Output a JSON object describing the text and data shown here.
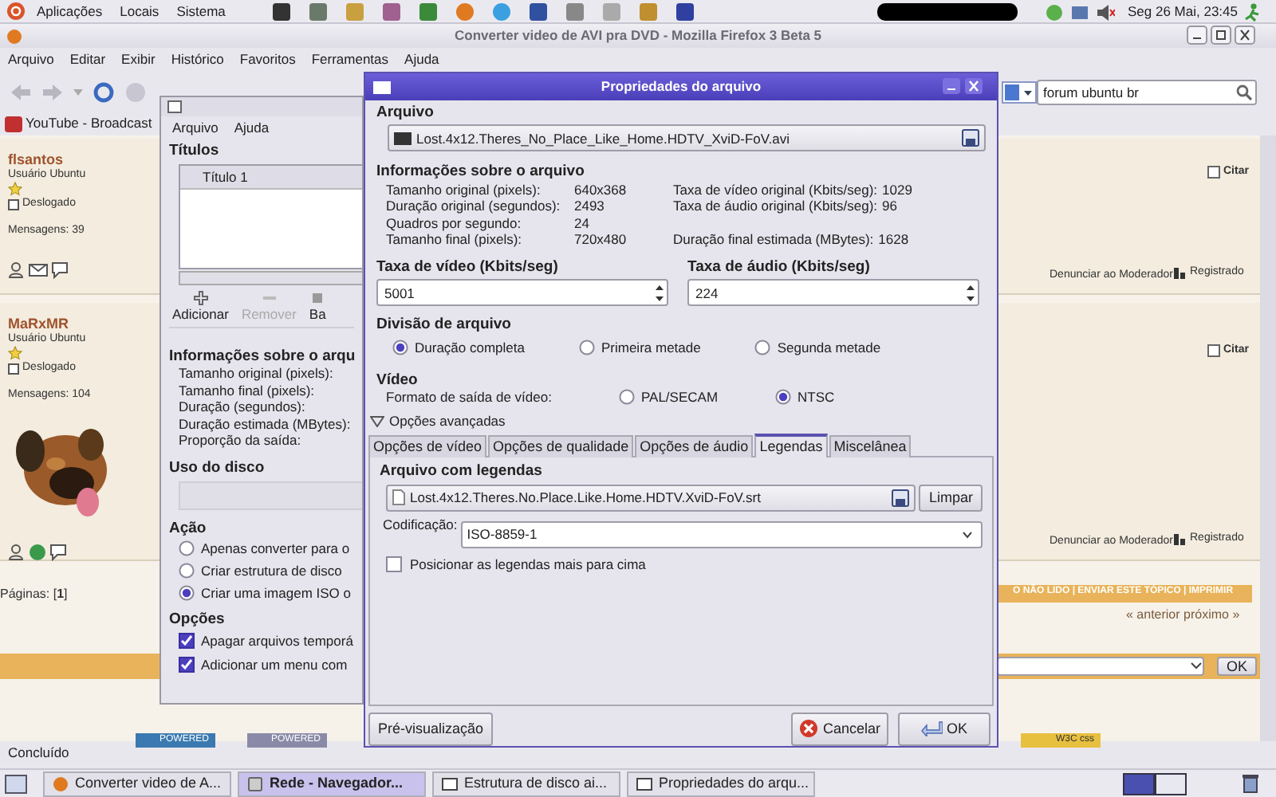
{
  "top_panel": {
    "menus": [
      "Aplicações",
      "Locais",
      "Sistema"
    ],
    "clock": "Seg 26 Mai, 23:45"
  },
  "browser": {
    "title": "Converter video de AVI pra DVD - Mozilla Firefox 3 Beta 5",
    "menus": [
      "Arquivo",
      "Editar",
      "Exibir",
      "Histórico",
      "Favoritos",
      "Ferramentas",
      "Ajuda"
    ],
    "search": {
      "value": "forum ubuntu br"
    },
    "bookmarks": [
      "YouTube - Broadcast"
    ],
    "posts": [
      {
        "author": "flsantos",
        "rank": "Usuário Ubuntu",
        "status": "Deslogado",
        "messages": "Mensagens: 39",
        "quote": "Citar",
        "report": "Denunciar ao Moderador",
        "registered": "Registrado"
      },
      {
        "author": "MaRxMR",
        "rank": "Usuário Ubuntu",
        "status": "Deslogado",
        "messages": "Mensagens: 104",
        "quote": "Citar",
        "report": "Denunciar ao Moderador",
        "registered": "Registrado"
      }
    ],
    "pages": "Páginas: [**1**]",
    "topic_links": "O NÃO LIDO | ENVIAR ESTE TÓPICO | IMPRIMIR",
    "nav": "« anterior próximo »",
    "jump_button": "OK",
    "badges": [
      "POWERED",
      "POWERED",
      "W3C css"
    ],
    "status": "Concluído"
  },
  "converter": {
    "menus": [
      "Arquivo",
      "Ajuda"
    ],
    "titles": {
      "heading": "Títulos",
      "column": "Título 1"
    },
    "toolbar": [
      {
        "label": "Adicionar",
        "disabled": false
      },
      {
        "label": "Remover",
        "disabled": true
      },
      {
        "label": "Ba",
        "disabled": false
      }
    ],
    "info": {
      "heading": "Informações sobre o arqu",
      "labels": [
        "Tamanho original (pixels):",
        "Tamanho final (pixels):",
        "Duração (segundos):",
        "Duração estimada (MBytes):",
        "Proporção da saída:"
      ]
    },
    "disk": {
      "heading": "Uso do disco"
    },
    "action": {
      "heading": "Ação",
      "options": [
        {
          "label": "Apenas converter para o",
          "selected": false
        },
        {
          "label": "Criar estrutura de disco",
          "selected": false
        },
        {
          "label": "Criar uma imagem ISO o",
          "selected": true
        }
      ]
    },
    "options": {
      "heading": "Opções",
      "items": [
        {
          "label": "Apagar arquivos temporá",
          "checked": true
        },
        {
          "label": "Adicionar um menu com",
          "checked": true
        }
      ]
    }
  },
  "dialog": {
    "title": "Propriedades do arquivo",
    "file_heading": "Arquivo",
    "file": "Lost.4x12.Theres_No_Place_Like_Home.HDTV_XviD-FoV.avi",
    "info_heading": "Informações sobre o arquivo",
    "info_rows": [
      {
        "label": "Tamanho original (pixels):",
        "value": "640x368",
        "right_label": "Taxa de vídeo original (Kbits/seg):",
        "right_value": "1029"
      },
      {
        "label": "Duração original (segundos):",
        "value": "2493",
        "right_label": "Taxa de áudio original (Kbits/seg):",
        "right_value": "96"
      },
      {
        "label": "Quadros por segundo:",
        "value": "24"
      },
      {
        "label": "Tamanho final (pixels):",
        "value": "720x480",
        "right_label": "Duração final estimada (MBytes):",
        "right_value": "1628"
      }
    ],
    "rates": [
      {
        "label": "Taxa de vídeo (Kbits/seg)",
        "value": "5001"
      },
      {
        "label": "Taxa de áudio (Kbits/seg)",
        "value": "224"
      }
    ],
    "split": {
      "heading": "Divisão de arquivo",
      "options": [
        {
          "label": "Duração completa",
          "selected": true
        },
        {
          "label": "Primeira metade",
          "selected": false
        },
        {
          "label": "Segunda metade",
          "selected": false
        }
      ]
    },
    "video": {
      "heading": "Vídeo",
      "label": "Formato de saída de vídeo:",
      "options": [
        {
          "label": "PAL/SECAM",
          "selected": false
        },
        {
          "label": "NTSC",
          "selected": true
        }
      ]
    },
    "advanced": {
      "label": "Opções avançadas",
      "expanded": true
    },
    "tabs": [
      {
        "label": "Opções de vídeo",
        "selected": false
      },
      {
        "label": "Opções de qualidade",
        "selected": false
      },
      {
        "label": "Opções de áudio",
        "selected": false
      },
      {
        "label": "Legendas",
        "selected": true
      },
      {
        "label": "Miscelânea",
        "selected": false
      }
    ],
    "subtitles": {
      "heading": "Arquivo com legendas",
      "file": "Lost.4x12.Theres.No.Place.Like.Home.HDTV.XviD-FoV.srt",
      "clear_button": "Limpar",
      "encoding_label": "Codificação:",
      "encoding": "ISO-8859-1",
      "raise": {
        "label": "Posicionar as legendas mais para cima",
        "checked": false
      }
    },
    "buttons": {
      "preview": "Pré-visualização",
      "cancel": "Cancelar",
      "ok": "OK"
    }
  },
  "taskbar": [
    {
      "label": "Converter video de A...",
      "selected": false
    },
    {
      "label": "Rede - Navegador...",
      "selected": true
    },
    {
      "label": "Estrutura de disco ai...",
      "selected": false
    },
    {
      "label": "Propriedades do arqu...",
      "selected": false
    }
  ]
}
